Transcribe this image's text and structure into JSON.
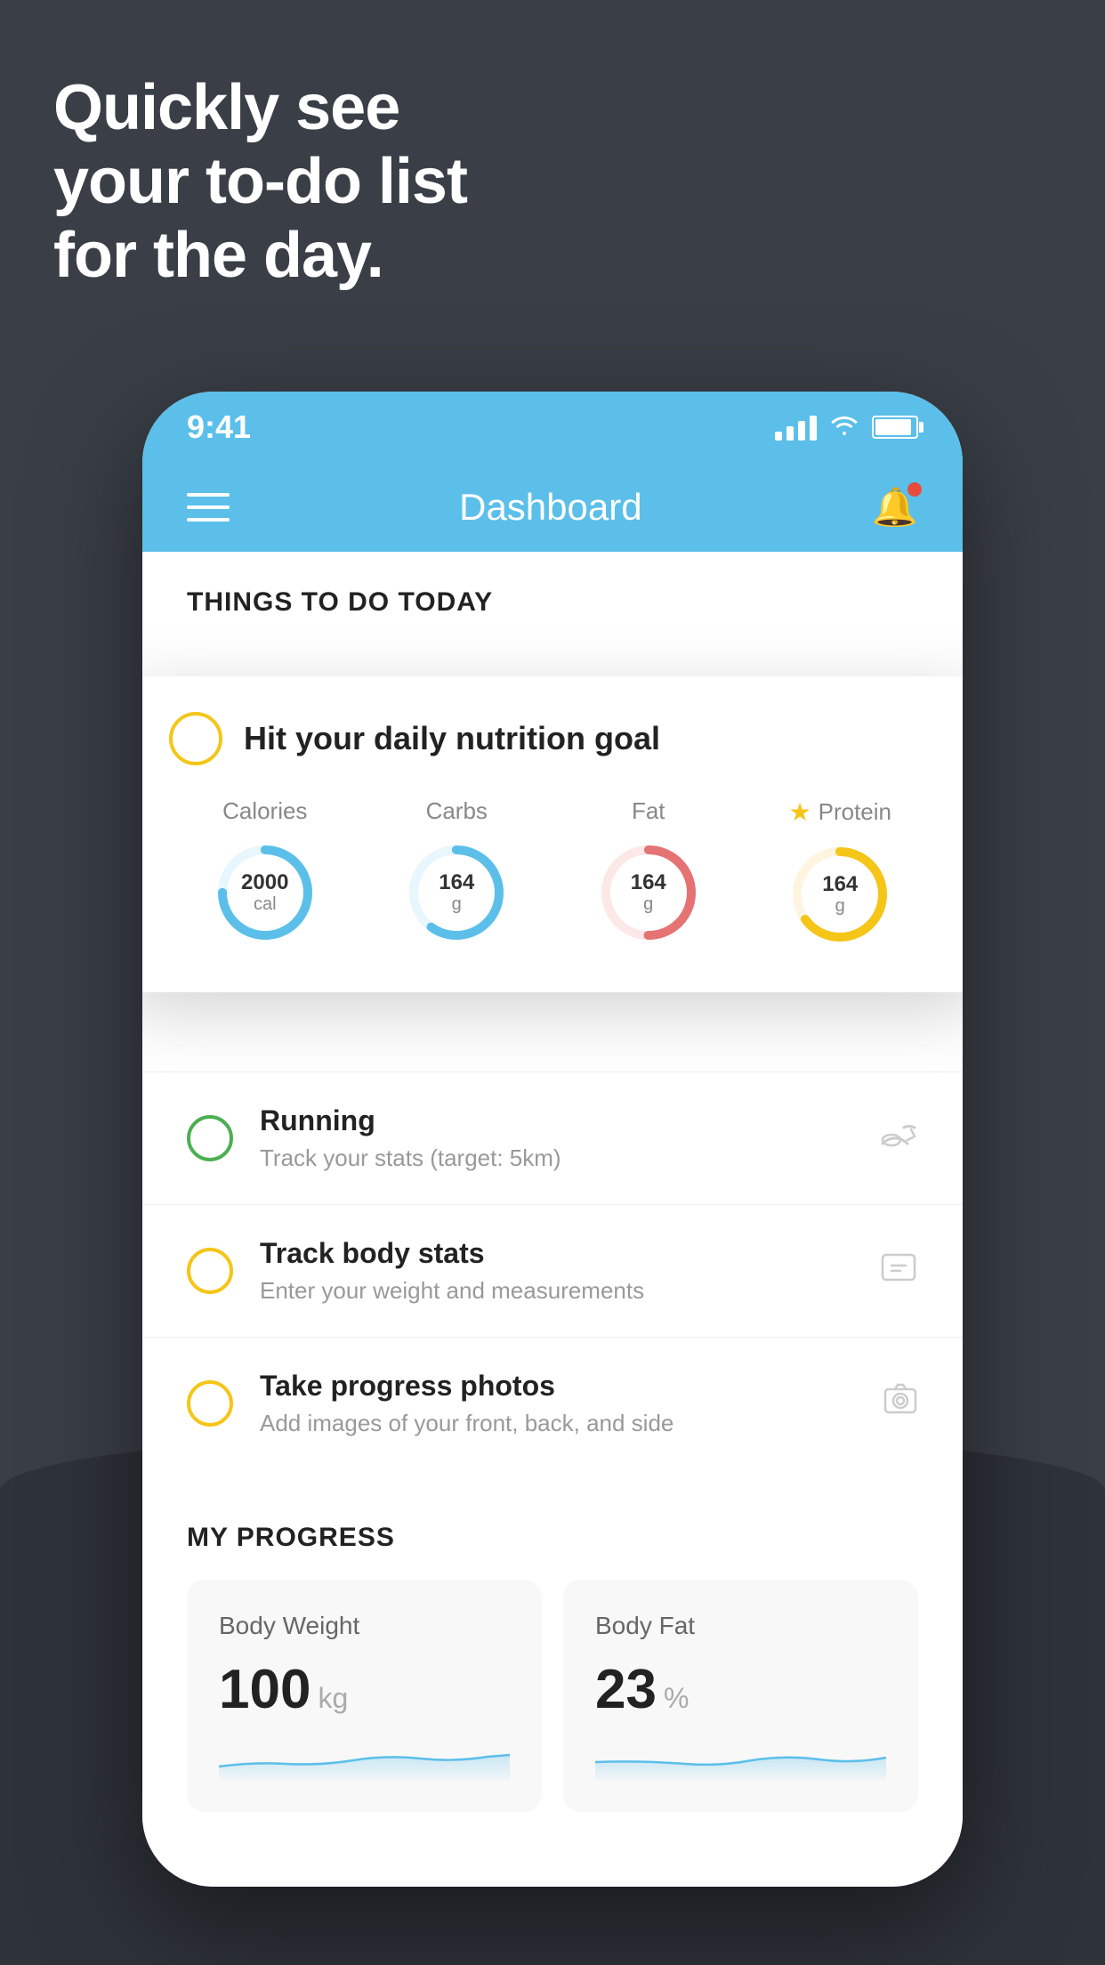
{
  "hero": {
    "line1": "Quickly see",
    "line2": "your to-do list",
    "line3": "for the day."
  },
  "status_bar": {
    "time": "9:41"
  },
  "header": {
    "title": "Dashboard"
  },
  "things_section": {
    "title": "THINGS TO DO TODAY"
  },
  "nutrition_card": {
    "title": "Hit your daily nutrition goal",
    "items": [
      {
        "label": "Calories",
        "value": "2000",
        "unit": "cal",
        "color": "#5bbfea",
        "track": 75
      },
      {
        "label": "Carbs",
        "value": "164",
        "unit": "g",
        "color": "#5bbfea",
        "track": 60
      },
      {
        "label": "Fat",
        "value": "164",
        "unit": "g",
        "color": "#e57373",
        "track": 50
      },
      {
        "label": "Protein",
        "value": "164",
        "unit": "g",
        "color": "#f5c518",
        "track": 65,
        "starred": true
      }
    ]
  },
  "todo_items": [
    {
      "title": "Running",
      "subtitle": "Track your stats (target: 5km)",
      "circle_color": "green",
      "icon": "👟"
    },
    {
      "title": "Track body stats",
      "subtitle": "Enter your weight and measurements",
      "circle_color": "yellow",
      "icon": "⚖️"
    },
    {
      "title": "Take progress photos",
      "subtitle": "Add images of your front, back, and side",
      "circle_color": "yellow",
      "icon": "🖼️"
    }
  ],
  "progress": {
    "section_title": "MY PROGRESS",
    "cards": [
      {
        "title": "Body Weight",
        "value": "100",
        "unit": "kg"
      },
      {
        "title": "Body Fat",
        "value": "23",
        "unit": "%"
      }
    ]
  }
}
